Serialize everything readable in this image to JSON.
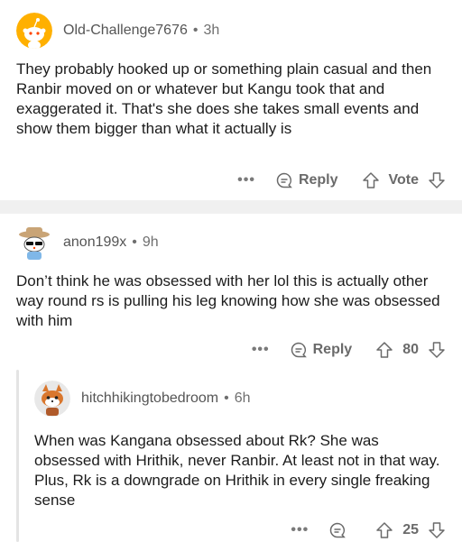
{
  "comments": [
    {
      "username": "Old-Challenge7676",
      "time": "3h",
      "body": "They probably hooked up or something plain casual and then Ranbir moved on or whatever but Kangu took that and exaggerated it. That's she does she takes small events and show them bigger than what it actually is",
      "more": "•••",
      "reply_label": "Reply",
      "vote_label": "Vote"
    },
    {
      "username": "anon199x",
      "time": "9h",
      "body": "Don’t think he was obsessed with her lol this is actually other way round rs is pulling his leg knowing how she was obsessed with him",
      "more": "•••",
      "reply_label": "Reply",
      "vote_count": "80"
    },
    {
      "username": "hitchhikingtobedroom",
      "time": "6h",
      "body": "When was Kangana obsessed about Rk? She was obsessed with Hrithik, never Ranbir. At least not in that way. Plus, Rk is a downgrade on Hrithik in every single freaking sense",
      "more": "•••",
      "vote_count": "25"
    }
  ],
  "separator": "•",
  "colors": {
    "avatar1_bg": "#ffb000",
    "avatar2_bg": "#ffffff",
    "avatar3_bg": "#e8e8e8",
    "text": "#1c1c1c",
    "meta": "#6f6f6f"
  }
}
